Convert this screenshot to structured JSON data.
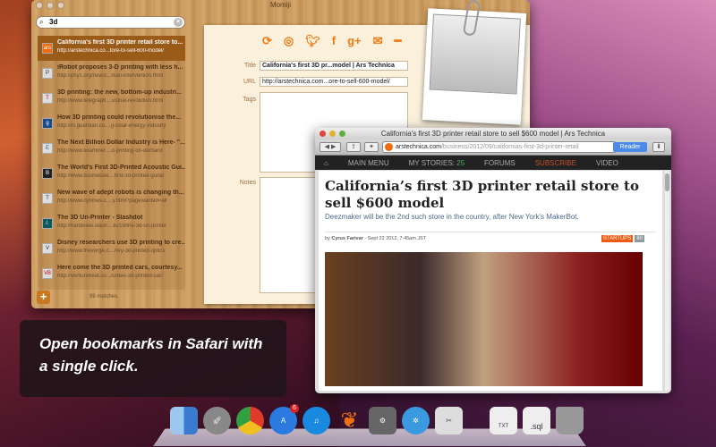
{
  "momiji": {
    "title": "Momiji",
    "search_value": "3d",
    "matches": "99 matches.",
    "items": [
      {
        "title": "California's first 3D printer retail store to...",
        "url": "http://arstechnica.co...tore-to-sell-600-model/",
        "fav": "ars"
      },
      {
        "title": "iRobot proposes 3-D printing with less h...",
        "url": "http://phys.org/news/...man-intervention.html",
        "fav": "P"
      },
      {
        "title": "3D printing: the new, bottom-up industri...",
        "url": "http://www.telegraph....ustrial-revolution.html",
        "fav": "T"
      },
      {
        "title": "How 3D printing could revolutionise the...",
        "url": "http://m.guardian.co....g-solar-energy-industry",
        "fav": "g"
      },
      {
        "title": "The Next Billion Dollar Industry is Here- \"...",
        "url": "http://www.examiner....d-printing-on-demand",
        "fav": "E"
      },
      {
        "title": "The World's First 3D-Printed Acoustic Gui...",
        "url": "http://www.businessw....first-3d-printed-guitar",
        "fav": "B"
      },
      {
        "title": "New wave of adept robots is changing th...",
        "url": "http://www.nytimes.c....y.html?pagewanted=all",
        "fav": "T"
      },
      {
        "title": "The 3D Un-Printer - Slashdot",
        "url": "http://hardware.slash....8219/the-3d-un-printer",
        "fav": "/."
      },
      {
        "title": "Disney researchers use 3D printing to cre...",
        "url": "http://www.theverge.c....ney-3d-printed-optics",
        "fav": "V"
      },
      {
        "title": "Here come the 3D printed cars, courtesy...",
        "url": "http://venturebeat.co.../urbee-3d-printed-car/",
        "fav": "VB"
      }
    ],
    "detail": {
      "title_label": "Title",
      "title_value": "California's first 3D pr...model | Ars Technica",
      "url_label": "URL",
      "url_value": "http://arstechnica.com...ore-to-sell-600-model/",
      "tags_label": "Tags",
      "notes_label": "Notes"
    },
    "actions": [
      "refresh-icon",
      "safari-icon",
      "twitter-icon",
      "facebook-icon",
      "google-plus-icon",
      "mail-icon",
      "delete-icon"
    ]
  },
  "safari": {
    "title": "California's first 3D printer retail store to sell $600 model | Ars Technica",
    "address_domain": "arstechnica.com",
    "address_path": "/business/2012/09/californias-first-3d-printer-retail",
    "reader": "Reader",
    "nav": [
      "MAIN MENU",
      "MY STORIES:",
      "FORUMS",
      "SUBSCRIBE",
      "VIDEO"
    ],
    "stories_count": "25",
    "headline": "California’s first 3D printer retail store to sell $600 model",
    "subhead": "Deezmaker will be the 2nd such store in the country, after New York's MakerBot.",
    "byline_prefix": "by ",
    "author": "Cyrus Farivar",
    "date": " - Sept 22 2012, 7:45am JST",
    "tag": "STARTUPS",
    "comments": "80"
  },
  "caption": "Open bookmarks in Safari with a single click.",
  "dock": {
    "badge": "6",
    "txt": "TXT",
    "sql": ".sql"
  },
  "colors": {
    "accent": "#f07a10",
    "selected": "#9a5a18"
  }
}
